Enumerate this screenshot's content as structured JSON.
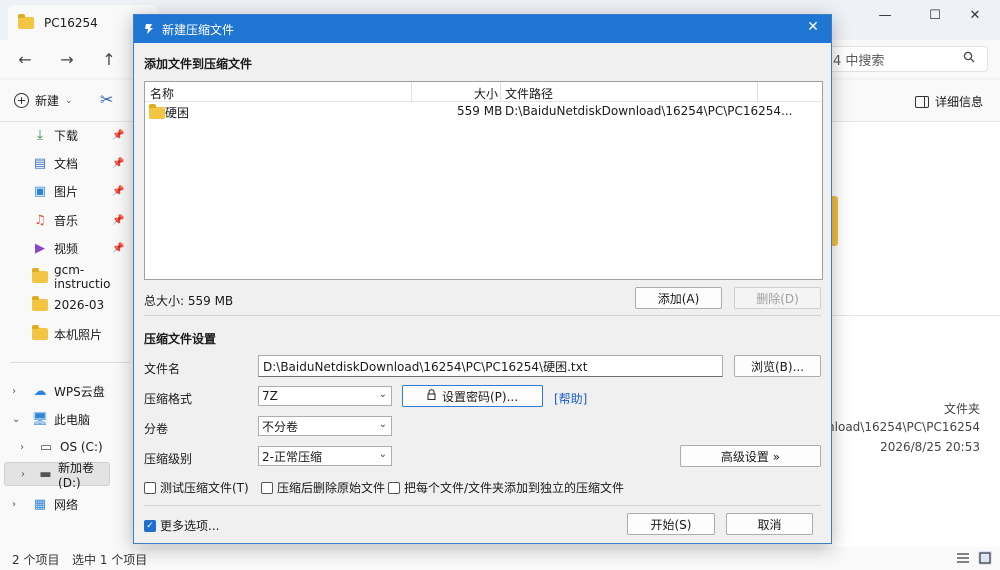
{
  "explorer": {
    "tab_title": "PC16254",
    "search_placeholder": "4 中搜索",
    "toolbar": {
      "new_label": "新建",
      "details_label": "详细信息"
    },
    "sidebar": {
      "quick_access": [
        {
          "label": "下载",
          "icon": "download-icon"
        },
        {
          "label": "文档",
          "icon": "document-icon"
        },
        {
          "label": "图片",
          "icon": "picture-icon"
        },
        {
          "label": "音乐",
          "icon": "music-icon"
        },
        {
          "label": "视频",
          "icon": "video-icon"
        },
        {
          "label": "gcm-instructio",
          "icon": "folder-icon"
        },
        {
          "label": "2026-03",
          "icon": "folder-icon"
        },
        {
          "label": "本机照片",
          "icon": "folder-icon"
        }
      ],
      "tree": [
        {
          "label": "WPS云盘",
          "icon": "cloud-icon"
        },
        {
          "label": "此电脑",
          "icon": "computer-icon"
        },
        {
          "label": "OS (C:)",
          "icon": "drive-icon"
        },
        {
          "label": "新加卷 (D:)",
          "icon": "drive-icon"
        },
        {
          "label": "网络",
          "icon": "network-icon"
        }
      ]
    },
    "details_pane": {
      "type": "文件夹",
      "path": "kDownload\\16254\\PC\\PC16254",
      "modified": "2026/8/25 20:53"
    },
    "status": {
      "item_count": "2 个项目",
      "selected": "选中 1 个项目"
    }
  },
  "dialog": {
    "title": "新建压缩文件",
    "add_section_title": "添加文件到压缩文件",
    "file_list": {
      "columns": {
        "name": "名称",
        "size": "大小",
        "path": "文件路径"
      },
      "rows": [
        {
          "name": "硬困",
          "size": "559 MB",
          "path": "D:\\BaiduNetdiskDownload\\16254\\PC\\PC16254..."
        }
      ]
    },
    "total_size": "总大小: 559 MB",
    "add_button": "添加(A)",
    "delete_button": "删除(D)",
    "settings_title": "压缩文件设置",
    "filename_label": "文件名",
    "filename_value": "D:\\BaiduNetdiskDownload\\16254\\PC\\PC16254\\硬困.txt",
    "browse_button": "浏览(B)...",
    "format_label": "压缩格式",
    "format_value": "7Z",
    "password_button": "设置密码(P)...",
    "help_link": "[帮助]",
    "split_label": "分卷",
    "split_value": "不分卷",
    "level_label": "压缩级别",
    "level_value": "2-正常压缩",
    "advanced_button": "高级设置 »",
    "checkboxes": {
      "test": "测试压缩文件(T)",
      "delete_after": "压缩后删除原始文件",
      "each_separate": "把每个文件/文件夹添加到独立的压缩文件"
    },
    "more_options": "更多选项...",
    "start_button": "开始(S)",
    "cancel_button": "取消"
  }
}
